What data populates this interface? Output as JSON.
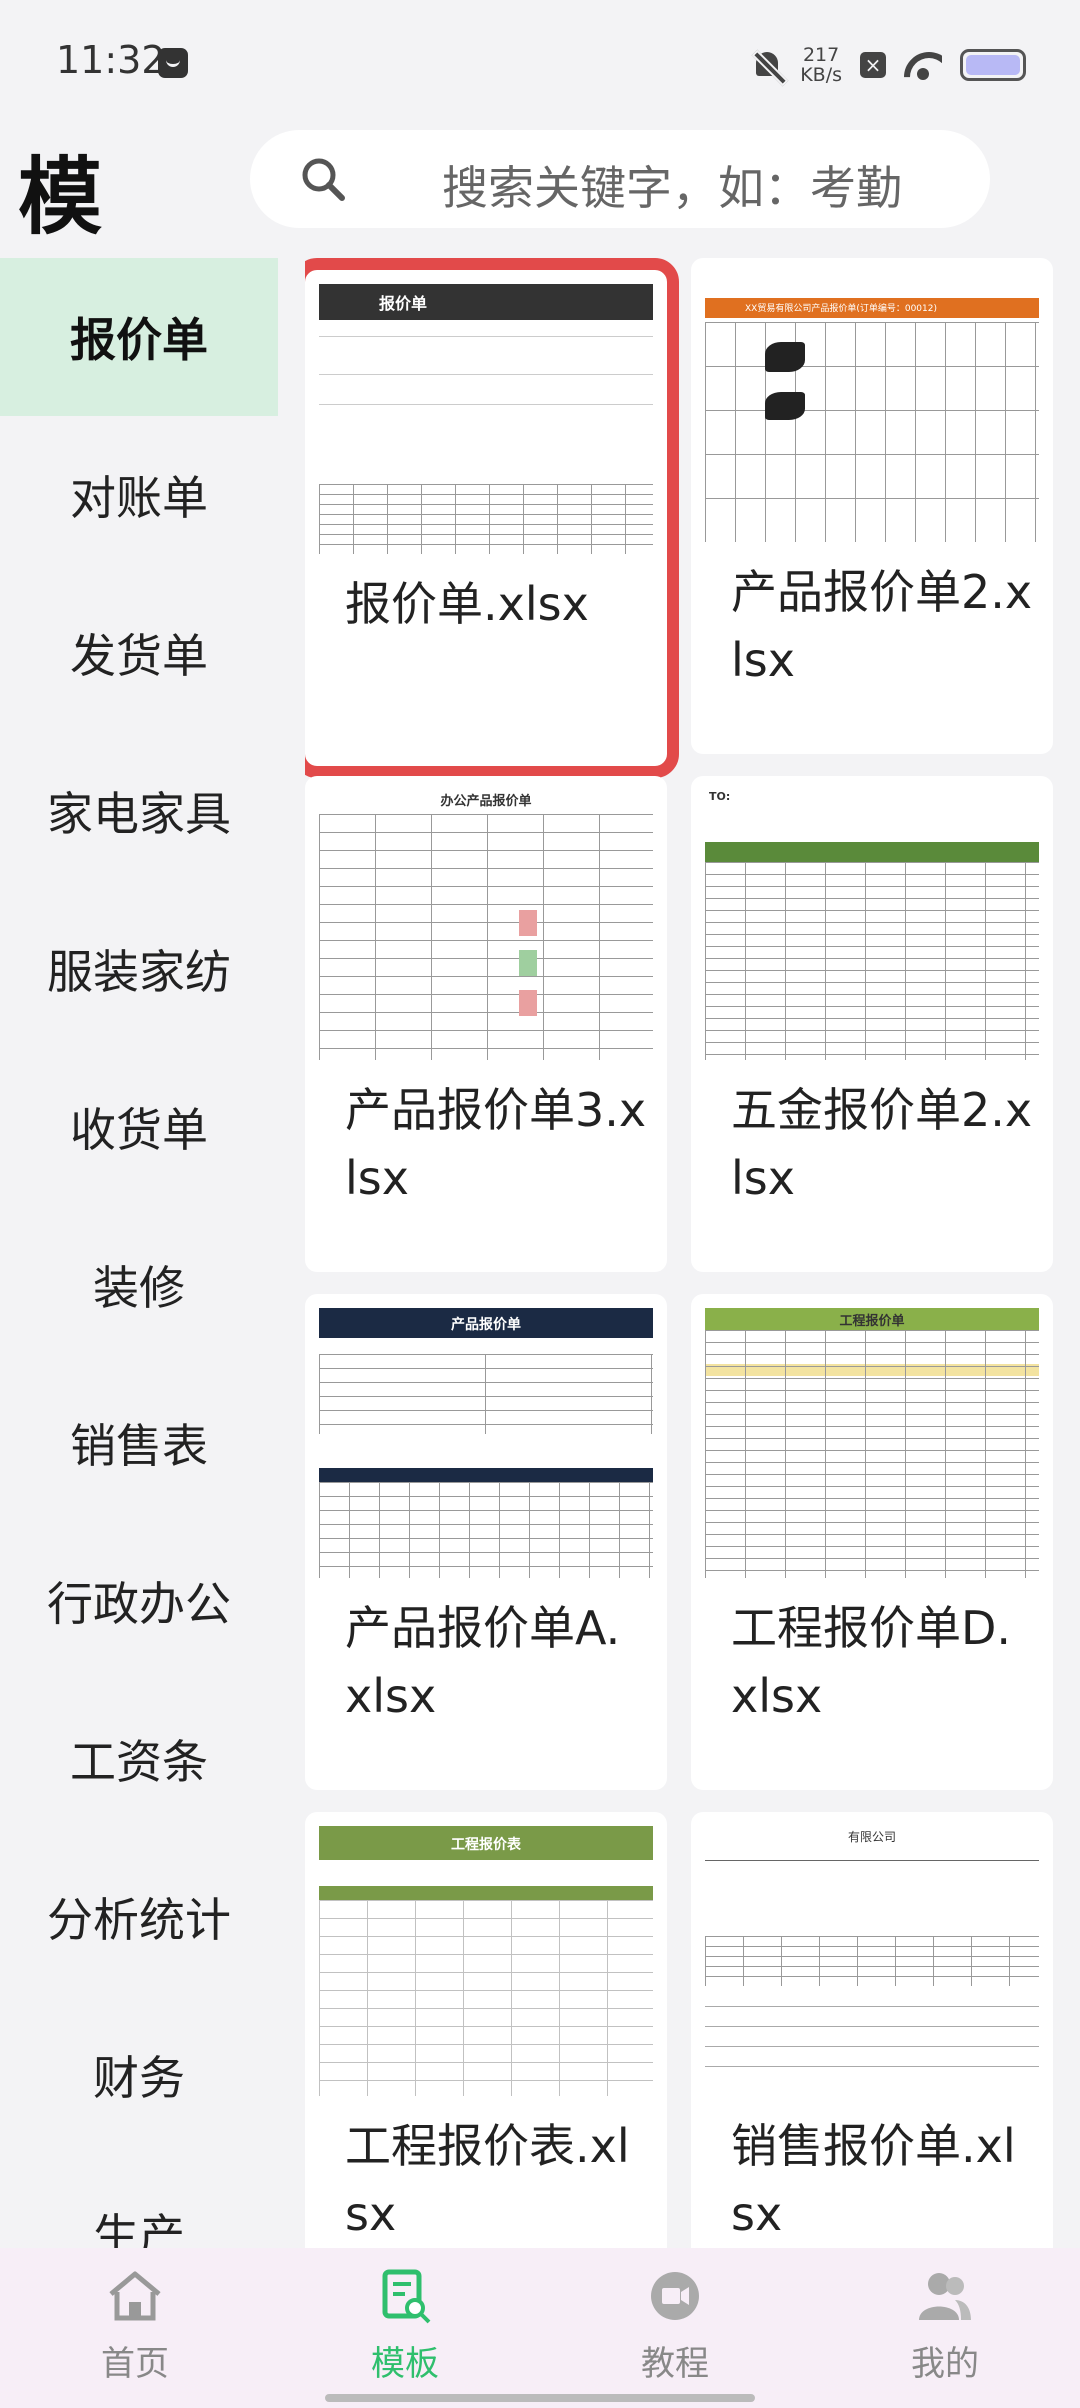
{
  "status_bar": {
    "time": "11:32",
    "net_speed_value": "217",
    "net_speed_unit": "KB/s"
  },
  "header": {
    "title": "模",
    "search_placeholder": "搜索关键字，如：考勤"
  },
  "sidebar": {
    "items": [
      {
        "label": "报价单",
        "active": true
      },
      {
        "label": "对账单"
      },
      {
        "label": "发货单"
      },
      {
        "label": "家电家具"
      },
      {
        "label": "服装家纺"
      },
      {
        "label": "收货单"
      },
      {
        "label": "装修"
      },
      {
        "label": "销售表"
      },
      {
        "label": "行政办公"
      },
      {
        "label": "工资条"
      },
      {
        "label": "分析统计"
      },
      {
        "label": "财务"
      },
      {
        "label": "生产"
      }
    ]
  },
  "templates": [
    {
      "title": "报价单.xlsx",
      "thumb_heading": "报价单",
      "selected": true
    },
    {
      "title": "产品报价单2.xlsx",
      "thumb_heading": "XX贸易有限公司产品报价单(订单编号：00012)"
    },
    {
      "title": "产品报价单3.xlsx",
      "thumb_heading": "办公产品报价单"
    },
    {
      "title": "五金报价单2.xlsx",
      "thumb_heading": "TO:"
    },
    {
      "title": "产品报价单A.xlsx",
      "thumb_heading": "产品报价单"
    },
    {
      "title": "工程报价单D.xlsx",
      "thumb_heading": "工程报价单"
    },
    {
      "title": "工程报价表.xlsx",
      "thumb_heading": "工程报价表"
    },
    {
      "title": "销售报价单.xlsx",
      "thumb_heading": "有限公司"
    }
  ],
  "bottom_nav": [
    {
      "label": "首页",
      "icon": "home-icon"
    },
    {
      "label": "模板",
      "icon": "template-icon",
      "active": true
    },
    {
      "label": "教程",
      "icon": "video-icon"
    },
    {
      "label": "我的",
      "icon": "profile-icon"
    }
  ],
  "colors": {
    "accent": "#2fbf6d",
    "selection": "#e24a4a",
    "sidebar_active": "#d7efe0"
  }
}
